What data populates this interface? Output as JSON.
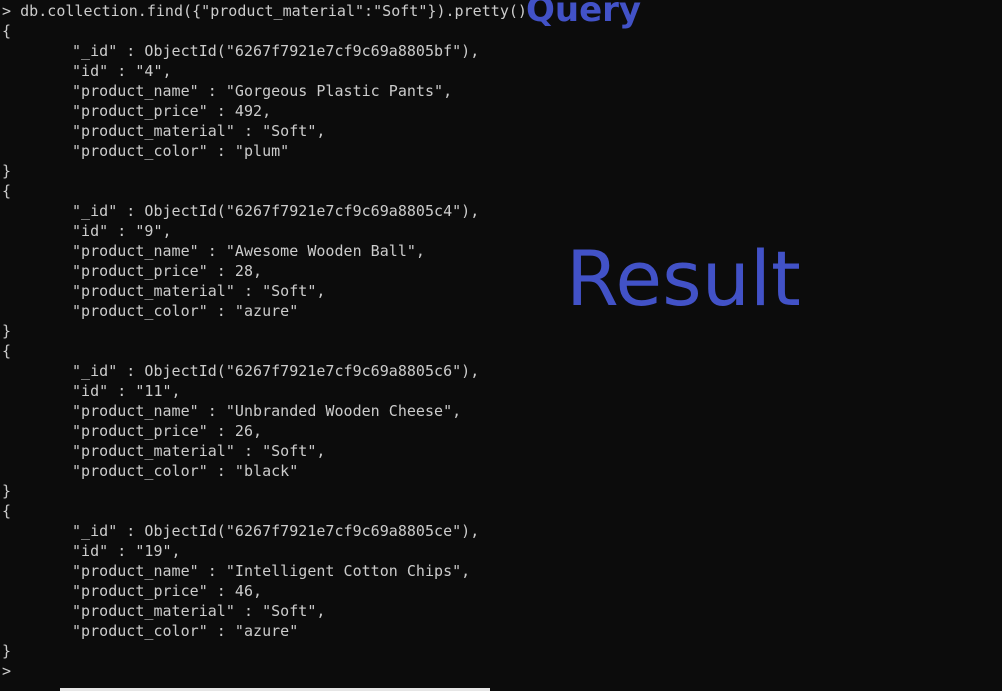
{
  "terminal": {
    "prompt": ">",
    "command": "db.collection.find({\"product_material\":\"Soft\"}).pretty()",
    "open_brace": "{",
    "close_brace": "}",
    "final_prompt": ">",
    "documents": [
      {
        "id_line": "\"_id\" : ObjectId(\"6267f7921e7cf9c69a8805bf\"),",
        "idnum_line": "\"id\" : \"4\",",
        "name_line": "\"product_name\" : \"Gorgeous Plastic Pants\",",
        "price_line": "\"product_price\" : 492,",
        "material_line": "\"product_material\" : \"Soft\",",
        "color_line": "\"product_color\" : \"plum\""
      },
      {
        "id_line": "\"_id\" : ObjectId(\"6267f7921e7cf9c69a8805c4\"),",
        "idnum_line": "\"id\" : \"9\",",
        "name_line": "\"product_name\" : \"Awesome Wooden Ball\",",
        "price_line": "\"product_price\" : 28,",
        "material_line": "\"product_material\" : \"Soft\",",
        "color_line": "\"product_color\" : \"azure\""
      },
      {
        "id_line": "\"_id\" : ObjectId(\"6267f7921e7cf9c69a8805c6\"),",
        "idnum_line": "\"id\" : \"11\",",
        "name_line": "\"product_name\" : \"Unbranded Wooden Cheese\",",
        "price_line": "\"product_price\" : 26,",
        "material_line": "\"product_material\" : \"Soft\",",
        "color_line": "\"product_color\" : \"black\""
      },
      {
        "id_line": "\"_id\" : ObjectId(\"6267f7921e7cf9c69a8805ce\"),",
        "idnum_line": "\"id\" : \"19\",",
        "name_line": "\"product_name\" : \"Intelligent Cotton Chips\",",
        "price_line": "\"product_price\" : 46,",
        "material_line": "\"product_material\" : \"Soft\",",
        "color_line": "\"product_color\" : \"azure\""
      }
    ]
  },
  "annotations": {
    "query": "Query",
    "result": "Result",
    "color": "#4252c7"
  }
}
